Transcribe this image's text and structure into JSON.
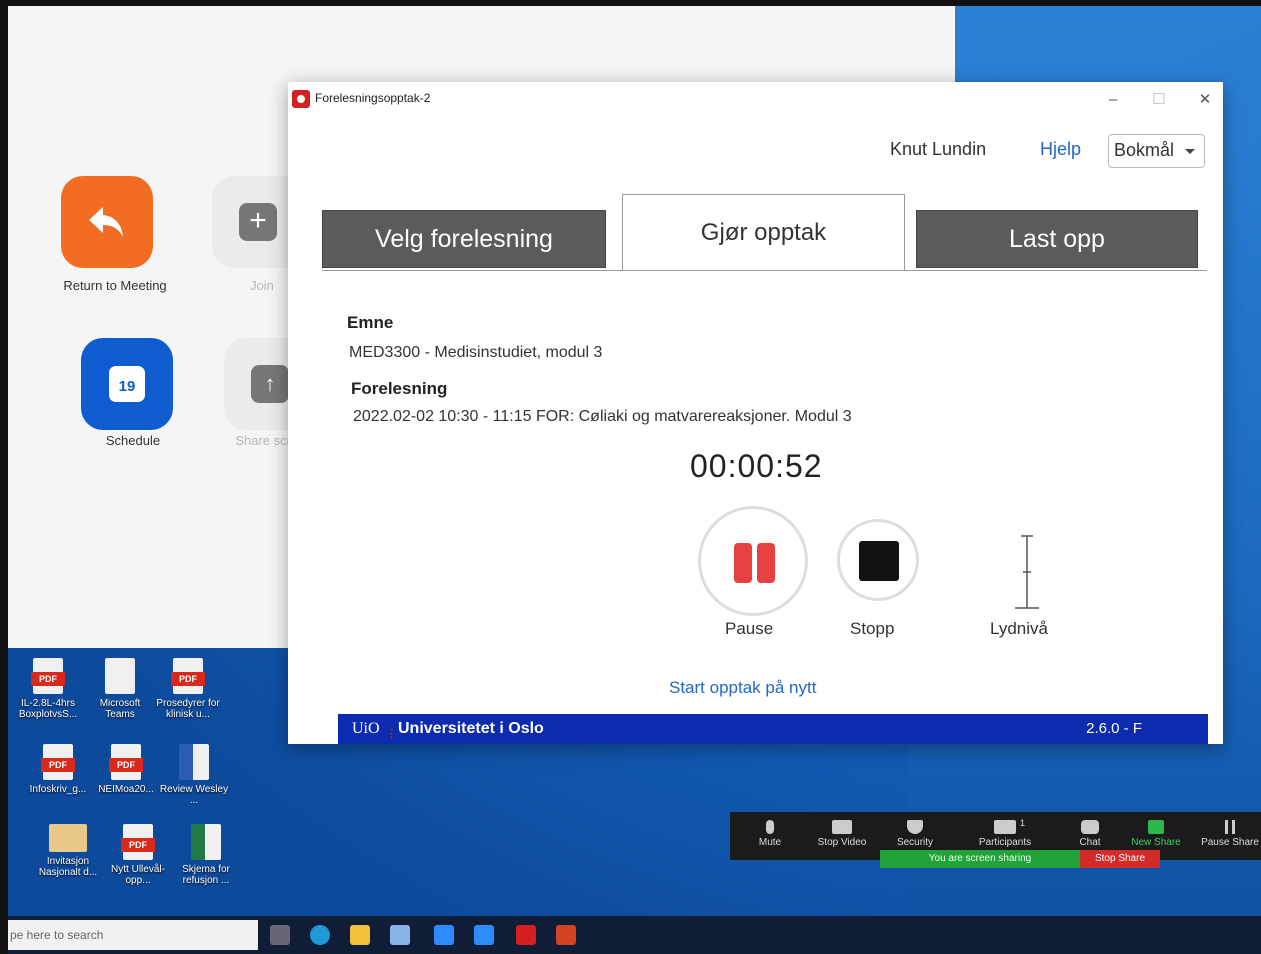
{
  "zoom_home": {
    "return_label": "Return to Meeting",
    "join_label": "Join",
    "schedule_label": "Schedule",
    "schedule_day": "19",
    "share_label": "Share screen"
  },
  "window": {
    "title": "Forelesningsopptak-2",
    "user": "Knut Lundin",
    "help": "Hjelp",
    "language": "Bokmål"
  },
  "tabs": [
    "Velg forelesning",
    "Gjør opptak",
    "Last opp"
  ],
  "recording": {
    "subject_heading": "Emne",
    "subject": "MED3300 - Medisinstudiet, modul 3",
    "lecture_heading": "Forelesning",
    "lecture": "2022.02-02 10:30 - 11:15 FOR: Cøliaki og matvarereaksjoner. Modul 3",
    "timer": "00:00:52",
    "pause_label": "Pause",
    "stop_label": "Stopp",
    "level_label": "Lydnivå",
    "restart_link": "Start opptak på nytt"
  },
  "footer": {
    "logo": "UiO",
    "university": "Universitetet i Oslo",
    "version": "2.6.0 - F"
  },
  "desktop_icons": [
    {
      "caption": "IL-2.8L-4hrs BoxplotvsS...",
      "type": "pdf"
    },
    {
      "caption": "Microsoft Teams",
      "type": "file"
    },
    {
      "caption": "Prosedyrer for klinisk u...",
      "type": "pdf"
    },
    {
      "caption": "Infoskriv_g...",
      "type": "pdf"
    },
    {
      "caption": "NEIMoa20...",
      "type": "pdf"
    },
    {
      "caption": "Review Wesley ...",
      "type": "word"
    },
    {
      "caption": "Invitasjon Nasjonalt d...",
      "type": "mail"
    },
    {
      "caption": "Nytt Ullevål-opp...",
      "type": "pdf"
    },
    {
      "caption": "Skjema for refusjon ...",
      "type": "excel"
    }
  ],
  "meeting_bar": {
    "mute": "Mute",
    "video": "Stop Video",
    "security": "Security",
    "participants": "Participants",
    "participants_count": "1",
    "chat": "Chat",
    "new_share": "New Share",
    "pause_share": "Pause Share",
    "sharing_note": "You are screen sharing",
    "stop_share": "Stop Share"
  },
  "taskbar": {
    "search_placeholder": "pe here to search"
  }
}
